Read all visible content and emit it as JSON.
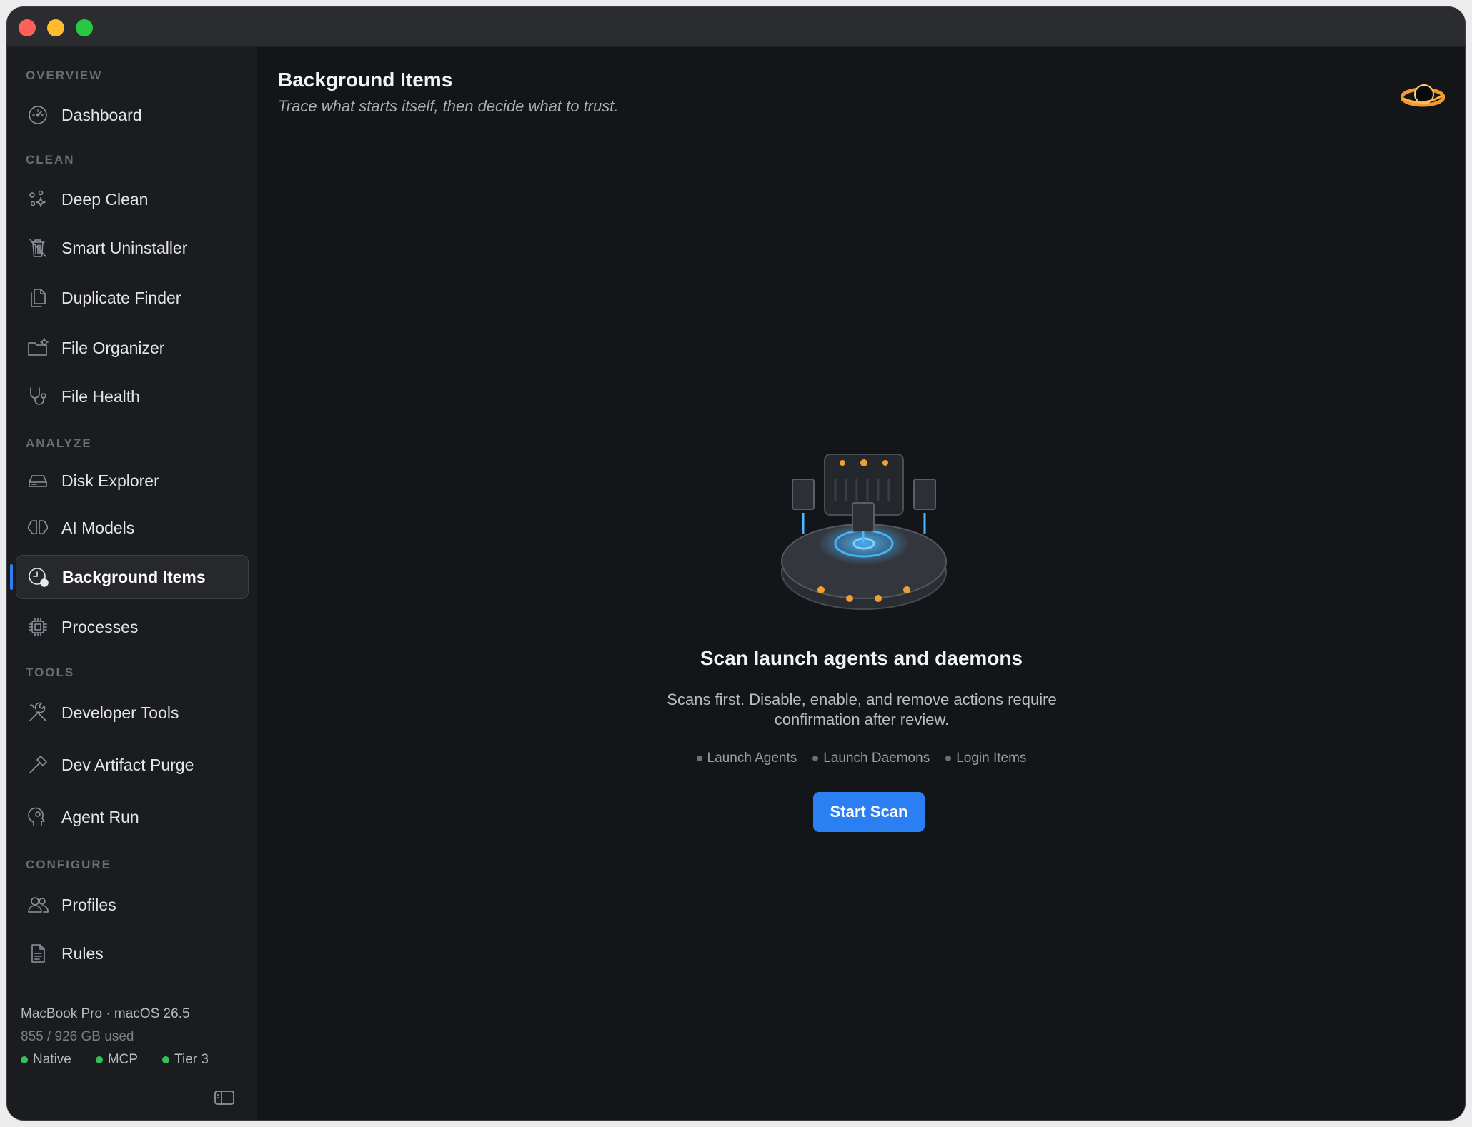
{
  "window": {
    "controls": [
      "close",
      "minimize",
      "zoom"
    ]
  },
  "sidebar": {
    "sections": [
      {
        "label": "OVERVIEW"
      },
      {
        "label": "CLEAN"
      },
      {
        "label": "ANALYZE"
      },
      {
        "label": "TOOLS"
      },
      {
        "label": "CONFIGURE"
      }
    ],
    "items": [
      {
        "label": "Dashboard",
        "icon": "gauge-icon"
      },
      {
        "label": "Deep Clean",
        "icon": "sparkles-icon"
      },
      {
        "label": "Smart Uninstaller",
        "icon": "trash-icon"
      },
      {
        "label": "Duplicate Finder",
        "icon": "documents-icon"
      },
      {
        "label": "File Organizer",
        "icon": "folder-gear-icon"
      },
      {
        "label": "File Health",
        "icon": "stethoscope-icon"
      },
      {
        "label": "Disk Explorer",
        "icon": "drive-icon"
      },
      {
        "label": "AI Models",
        "icon": "brain-icon"
      },
      {
        "label": "Background Items",
        "icon": "clock-badge-icon",
        "active": true
      },
      {
        "label": "Processes",
        "icon": "cpu-icon"
      },
      {
        "label": "Developer Tools",
        "icon": "wrench-screwdriver-icon"
      },
      {
        "label": "Dev Artifact Purge",
        "icon": "hammer-icon"
      },
      {
        "label": "Agent Run",
        "icon": "head-icon"
      },
      {
        "label": "Profiles",
        "icon": "people-icon"
      },
      {
        "label": "Rules",
        "icon": "doc-icon"
      }
    ],
    "footer": {
      "machine": "MacBook Pro · macOS 26.5",
      "disk": "855 / 926 GB used",
      "badges": [
        "Native",
        "MCP",
        "Tier 3"
      ]
    }
  },
  "header": {
    "title": "Background Items",
    "subtitle": "Trace what starts itself, then decide what to trust."
  },
  "empty_state": {
    "title": "Scan launch agents and daemons",
    "description": "Scans first. Disable, enable, and remove actions require confirmation after review.",
    "chips": [
      "Launch Agents",
      "Launch Daemons",
      "Login Items"
    ],
    "button": "Start Scan"
  },
  "colors": {
    "accent": "#2a7ff3",
    "status_ok": "#35c15a",
    "background": "#131518",
    "sidebar": "#1b1c1f"
  }
}
